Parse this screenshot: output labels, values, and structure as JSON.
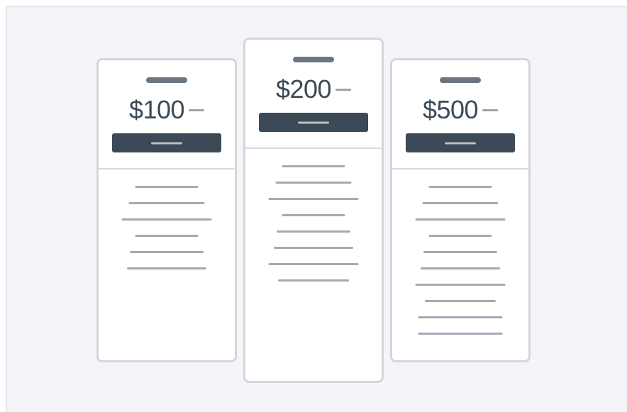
{
  "colors": {
    "background": "#f4f5f9",
    "card": "#ffffff",
    "card_border": "#d2d6dc",
    "dark": "#3c4a57",
    "placeholder": "#a2aab5"
  },
  "plans": [
    {
      "price": "$100",
      "cta_icon": "placeholder-line",
      "feature_count": 6
    },
    {
      "price": "$200",
      "cta_icon": "placeholder-line",
      "feature_count": 8
    },
    {
      "price": "$500",
      "cta_icon": "placeholder-line",
      "feature_count": 10
    }
  ]
}
